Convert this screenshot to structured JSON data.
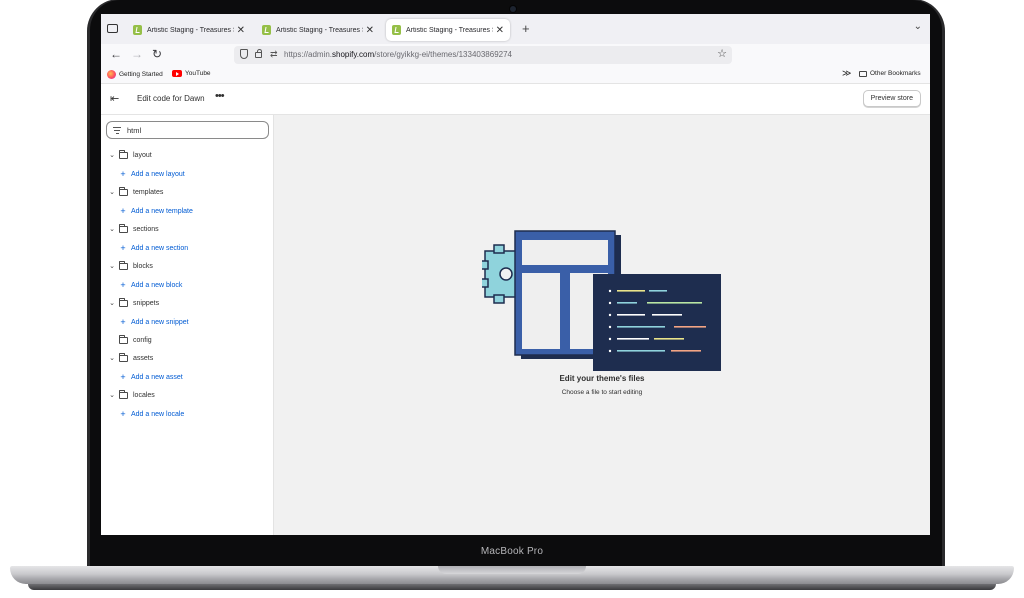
{
  "device": {
    "label": "MacBook Pro"
  },
  "browser": {
    "tabs": [
      {
        "title": "Artistic Staging - Treasures Sto",
        "close": "✕",
        "active": false
      },
      {
        "title": "Artistic Staging - Treasures Sto",
        "close": "✕",
        "active": false
      },
      {
        "title": "Artistic Staging - Treasures Sto",
        "close": "✕",
        "active": true
      }
    ],
    "new_tab": "+",
    "tab_menu": "⌄",
    "url": {
      "prefix": "https://admin.",
      "domain": "shopify.com",
      "path": "/store/gyikkg-ei/themes/133403869274"
    },
    "bookmarks": [
      {
        "label": "Getting Started",
        "icon": "firefox-icon"
      },
      {
        "label": "YouTube",
        "icon": "youtube-icon"
      }
    ],
    "other_bookmarks": "Other Bookmarks",
    "overflow": "≫"
  },
  "app": {
    "title": "Edit code for Dawn",
    "more": "•••",
    "preview_button": "Preview store"
  },
  "sidebar": {
    "search_value": "html",
    "items": [
      {
        "label": "layout",
        "add": "Add a new layout"
      },
      {
        "label": "templates",
        "add": "Add a new template"
      },
      {
        "label": "sections",
        "add": "Add a new section"
      },
      {
        "label": "blocks",
        "add": "Add a new block"
      },
      {
        "label": "snippets",
        "add": "Add a new snippet"
      },
      {
        "label": "config",
        "add": null
      },
      {
        "label": "assets",
        "add": "Add a new asset"
      },
      {
        "label": "locales",
        "add": "Add a new locale"
      }
    ]
  },
  "main": {
    "empty_title": "Edit your theme's files",
    "empty_subtitle": "Choose a file to start editing"
  },
  "colors": {
    "accent_link": "#005bd3",
    "illustration_blue": "#3a5fa8",
    "illustration_navy": "#1e2d4f",
    "gear": "#8fd3dc"
  }
}
